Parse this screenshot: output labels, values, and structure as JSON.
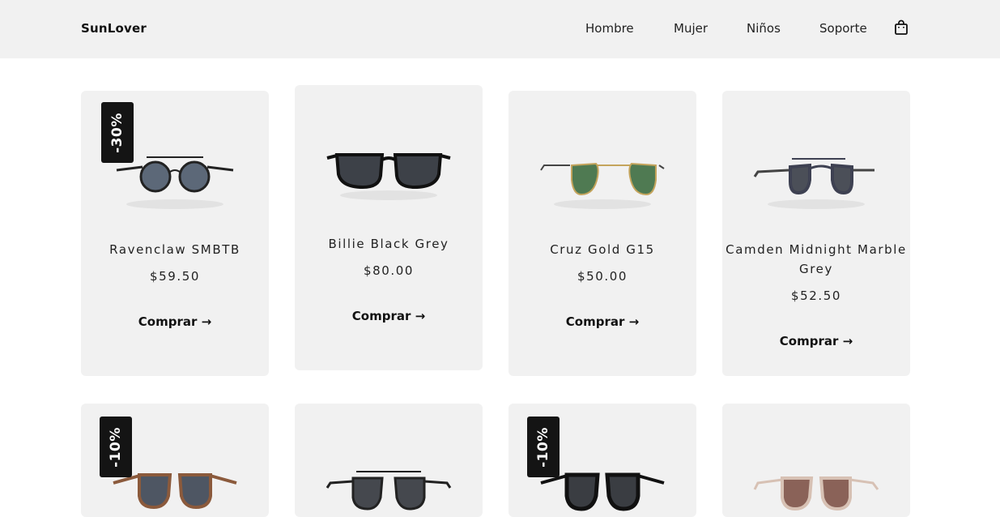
{
  "header": {
    "brand": "SunLover",
    "nav": [
      "Hombre",
      "Mujer",
      "Niños",
      "Soporte"
    ],
    "cart_icon": "shopping-bag-icon"
  },
  "products": [
    {
      "name": "Ravenclaw SMBTB",
      "price": "$59.50",
      "buy_label": "Comprar →",
      "badge": "-30%",
      "lens_color": "#5c6878",
      "frame_color": "#222222"
    },
    {
      "name": "Billie Black Grey",
      "price": "$80.00",
      "buy_label": "Comprar →",
      "badge": "",
      "lens_color": "#3d4148",
      "frame_color": "#111111"
    },
    {
      "name": "Cruz Gold G15",
      "price": "$50.00",
      "buy_label": "Comprar →",
      "badge": "",
      "lens_color": "#4f7a52",
      "frame_color": "#c4a45c"
    },
    {
      "name": "Camden Midnight Marble Grey",
      "price": "$52.50",
      "buy_label": "Comprar →",
      "badge": "",
      "lens_color": "#4b4f58",
      "frame_color": "#3e4152"
    },
    {
      "badge": "-10%",
      "lens_color": "#4e5663",
      "frame_color": "#8b5a3c"
    },
    {
      "badge": "",
      "lens_color": "#45484e",
      "frame_color": "#222222"
    },
    {
      "badge": "-10%",
      "lens_color": "#3a3d42",
      "frame_color": "#111111"
    },
    {
      "badge": "",
      "lens_color": "#8a6258",
      "frame_color": "#d7c1b4"
    }
  ]
}
